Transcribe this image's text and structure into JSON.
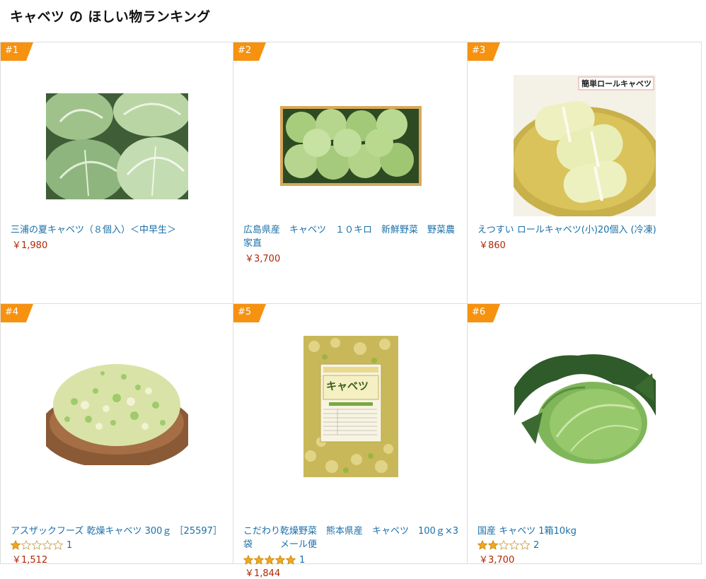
{
  "page": {
    "title": "キャベツ の ほしい物ランキング"
  },
  "colors": {
    "badge": "#f6920f",
    "link": "#1a6fa8",
    "price": "#b12704",
    "star": "#f0a81c"
  },
  "items": [
    {
      "rank": "#1",
      "title": "三浦の夏キャベツ（８個入）＜中早生＞",
      "price": "￥1,980",
      "rating": null,
      "review_count": "",
      "image": "cabbage-heads-photo"
    },
    {
      "rank": "#2",
      "title": "広島県産　キャベツ　１０キロ　新鮮野菜　野菜農家直",
      "price": "￥3,700",
      "rating": null,
      "review_count": "",
      "image": "cabbage-box-photo"
    },
    {
      "rank": "#3",
      "title": "えつすい ロールキャベツ(小)20個入 (冷凍)",
      "price": "￥860",
      "rating": null,
      "review_count": "",
      "image": "cabbage-roll-photo",
      "image_caption": "簡単ロールキャベツ"
    },
    {
      "rank": "#4",
      "title": "アスザックフーズ 乾燥キャベツ 300ｇ ［25597］",
      "price": "￥1,512",
      "rating": 1,
      "review_count": "1",
      "image": "dried-cabbage-plate-photo"
    },
    {
      "rank": "#5",
      "title": "こだわり乾燥野菜　熊本県産　キャベツ　100ｇ×3袋　　　メール便",
      "price": "￥1,844",
      "rating": 5,
      "review_count": "1",
      "image": "dried-cabbage-bag-photo",
      "image_caption": "キャベツ"
    },
    {
      "rank": "#6",
      "title": "国産 キャベツ 1箱10kg",
      "price": "￥3,700",
      "rating": 2,
      "review_count": "2",
      "image": "whole-cabbage-photo"
    }
  ]
}
